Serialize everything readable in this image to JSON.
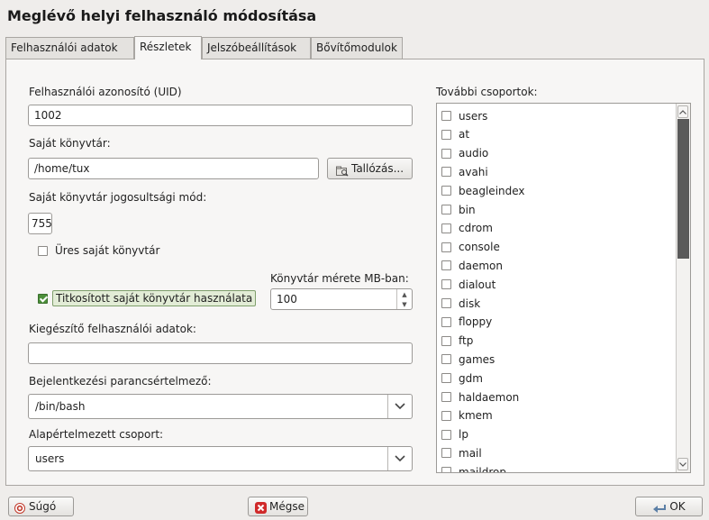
{
  "window": {
    "title": "Meglévő helyi felhasználó módosítása"
  },
  "tabs": [
    {
      "label": "Felhasználói adatok",
      "mnemonic": "F"
    },
    {
      "label": "Részletek",
      "mnemonic": "R"
    },
    {
      "label": "Jelszóbeállítások",
      "mnemonic": "l"
    },
    {
      "label": "Bővítőmodulok",
      "mnemonic": "B"
    }
  ],
  "uid": {
    "label": "Felhasználói azonosító (UID)",
    "value": "1002"
  },
  "home": {
    "label": "Saját könyvtár:",
    "value": "/home/tux",
    "browse_label": "Tallózás..."
  },
  "home_perm": {
    "label": "Saját könyvtár jogosultsági mód:",
    "value": "755"
  },
  "empty_home": {
    "label": "Üres saját könyvtár",
    "checked": false
  },
  "dir_size": {
    "label": "Könyvtár mérete MB-ban:",
    "value": "100"
  },
  "encrypted": {
    "label": "Titkosított saját könyvtár használata",
    "checked": true
  },
  "extra_info": {
    "label": "Kiegészítő felhasználói adatok:",
    "value": ""
  },
  "shell": {
    "label": "Bejelentkezési parancsértelmező:",
    "value": "/bin/bash"
  },
  "default_group": {
    "label": "Alapértelmezett csoport:",
    "value": "users"
  },
  "groups": {
    "label": "További csoportok:",
    "items": [
      "users",
      "at",
      "audio",
      "avahi",
      "beagleindex",
      "bin",
      "cdrom",
      "console",
      "daemon",
      "dialout",
      "disk",
      "floppy",
      "ftp",
      "games",
      "gdm",
      "haldaemon",
      "kmem",
      "lp",
      "mail",
      "maildrop"
    ]
  },
  "footer": {
    "help_label": "Súgó",
    "cancel_label": "Mégse",
    "ok_label": "OK"
  }
}
